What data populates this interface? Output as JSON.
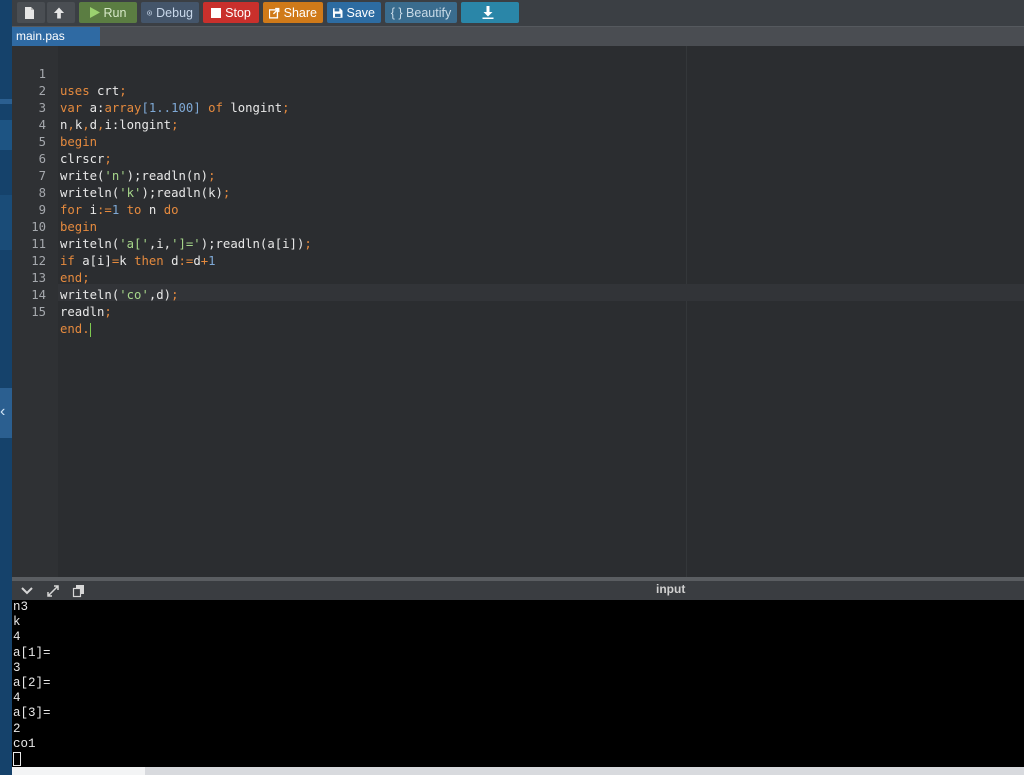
{
  "toolbar": {
    "run": "Run",
    "debug": "Debug",
    "stop": "Stop",
    "share": "Share",
    "save": "Save",
    "beautify": "{ } Beautify"
  },
  "tab": {
    "filename": "main.pas"
  },
  "editor": {
    "lines": [
      {
        "n": "1"
      },
      {
        "n": "2"
      },
      {
        "n": "3"
      },
      {
        "n": "4"
      },
      {
        "n": "5"
      },
      {
        "n": "6"
      },
      {
        "n": "7"
      },
      {
        "n": "8"
      },
      {
        "n": "9"
      },
      {
        "n": "10"
      },
      {
        "n": "11"
      },
      {
        "n": "12"
      },
      {
        "n": "13"
      },
      {
        "n": "14"
      },
      {
        "n": "15"
      }
    ],
    "code": {
      "l1a": "uses ",
      "l1b": "crt",
      "l1c": ";",
      "l2a": "var ",
      "l2b": "a:",
      "l2c": "array",
      "l2d": "[",
      "l2e": "1",
      "l2f": "..",
      "l2g": "100",
      "l2h": "] ",
      "l2i": "of",
      "l2j": " longint",
      "l2k": ";",
      "l3a": "n",
      "l3b": ",",
      "l3c": "k",
      "l3d": ",",
      "l3e": "d",
      "l3f": ",",
      "l3g": "i:longint",
      "l3h": ";",
      "l4": "begin",
      "l5a": "clrscr",
      "l5b": ";",
      "l6a": "write(",
      "l6b": "'n'",
      "l6c": ");",
      "l6d": "readln(n)",
      "l6e": ";",
      "l7a": "writeln(",
      "l7b": "'k'",
      "l7c": ");",
      "l7d": "readln(k)",
      "l7e": ";",
      "l8a": "for",
      "l8b": " i",
      "l8c": ":=",
      "l8d": "1",
      "l8e": " to",
      "l8f": " n ",
      "l8g": "do",
      "l9": "begin",
      "l10a": "writeln(",
      "l10b": "'a['",
      "l10c": ",i,",
      "l10d": "']='",
      "l10e": ");",
      "l10f": "readln(a[i])",
      "l10g": ";",
      "l11a": "if",
      "l11b": " a[i]",
      "l11c": "=",
      "l11d": "k ",
      "l11e": "then",
      "l11f": " d",
      "l11g": ":=",
      "l11h": "d",
      "l11i": "+",
      "l11j": "1",
      "l12a": "end",
      "l12b": ";",
      "l13a": "writeln(",
      "l13b": "'co'",
      "l13c": ",d)",
      "l13d": ";",
      "l14a": "readln",
      "l14b": ";",
      "l15a": "end",
      "l15b": "."
    }
  },
  "console": {
    "title": "input",
    "output": [
      "n3",
      "k",
      "4",
      "a[1]=",
      "3",
      "a[2]=",
      "4",
      "a[3]=",
      "2",
      "co1"
    ]
  },
  "colors": {
    "keyword": "#e58a3e",
    "number": "#7fa9d6",
    "string": "#a6d68a",
    "run": "#5b7d42",
    "stop": "#c9302c",
    "share": "#d07a19",
    "save": "#2d6ca2"
  }
}
